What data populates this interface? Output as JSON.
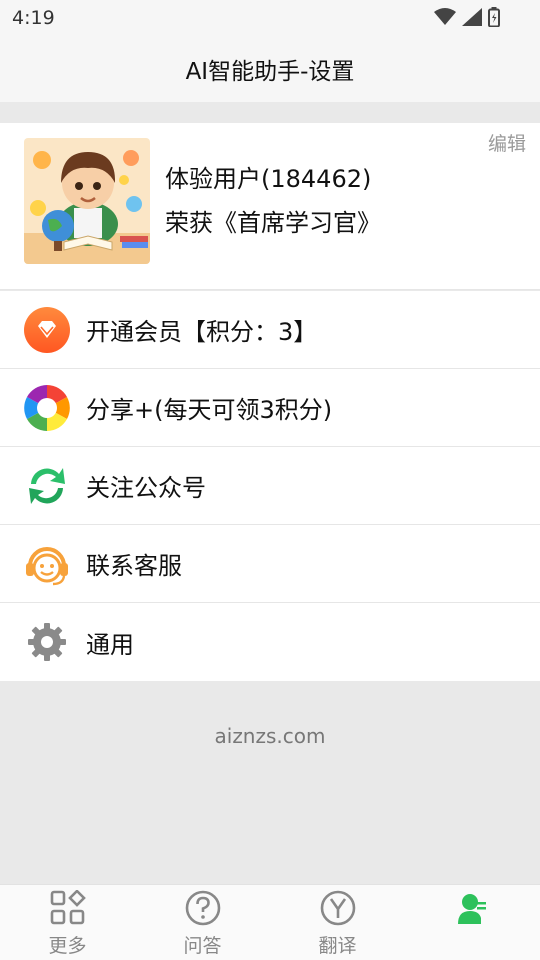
{
  "status_bar": {
    "time": "4:19"
  },
  "header": {
    "title": "AI智能助手-设置"
  },
  "profile": {
    "edit_label": "编辑",
    "name": "体验用户(184462)",
    "honor": "荣获《首席学习官》"
  },
  "menu": [
    {
      "label": "开通会员【积分：3】",
      "icon": "diamond-icon"
    },
    {
      "label": "分享+(每天可领3积分)",
      "icon": "share-aperture-icon"
    },
    {
      "label": "关注公众号",
      "icon": "recycle-arrows-icon"
    },
    {
      "label": "联系客服",
      "icon": "headset-icon"
    },
    {
      "label": "通用",
      "icon": "gear-icon"
    }
  ],
  "footer": {
    "site": "aiznzs.com"
  },
  "tab_bar": [
    {
      "label": "更多",
      "icon": "grid-icon"
    },
    {
      "label": "问答",
      "icon": "question-icon"
    },
    {
      "label": "翻译",
      "icon": "translate-icon"
    },
    {
      "label": "",
      "icon": "user-settings-icon",
      "active": true
    }
  ],
  "colors": {
    "accent_green": "#2dc15b",
    "vip_orange": "#ff6a2a",
    "wechat_green": "#2bbf6a",
    "service_orange": "#f7a23b",
    "tab_gray": "#888888"
  }
}
